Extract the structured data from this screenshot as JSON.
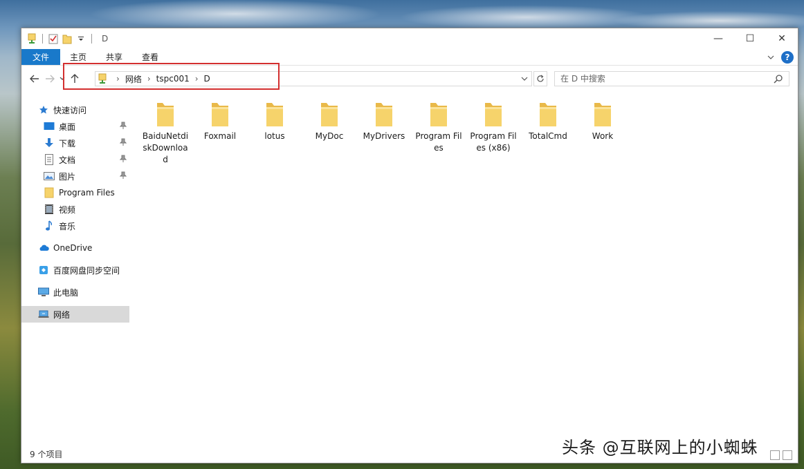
{
  "window": {
    "title": "D",
    "controls": {
      "minimize": "—",
      "maximize": "☐",
      "close": "✕"
    }
  },
  "ribbon": {
    "tabs": [
      {
        "label": "文件"
      },
      {
        "label": "主页"
      },
      {
        "label": "共享"
      },
      {
        "label": "查看"
      }
    ]
  },
  "address": {
    "breadcrumbs": [
      "网络",
      "tspc001",
      "D"
    ]
  },
  "search": {
    "placeholder": "在 D 中搜索"
  },
  "sidebar": {
    "items": [
      {
        "label": "快速访问",
        "icon": "star-icon"
      },
      {
        "label": "桌面",
        "icon": "desktop-icon",
        "pinned": true
      },
      {
        "label": "下载",
        "icon": "download-icon",
        "pinned": true
      },
      {
        "label": "文档",
        "icon": "document-icon",
        "pinned": true
      },
      {
        "label": "图片",
        "icon": "picture-icon",
        "pinned": true
      },
      {
        "label": "Program Files",
        "icon": "folder-icon"
      },
      {
        "label": "视频",
        "icon": "video-icon"
      },
      {
        "label": "音乐",
        "icon": "music-icon"
      },
      {
        "label": "OneDrive",
        "icon": "cloud-icon"
      },
      {
        "label": "百度网盘同步空间",
        "icon": "baidu-sync-icon"
      },
      {
        "label": "此电脑",
        "icon": "computer-icon"
      },
      {
        "label": "网络",
        "icon": "network-icon",
        "selected": true
      }
    ]
  },
  "content": {
    "folders": [
      {
        "label": "BaiduNetdiskDownload"
      },
      {
        "label": "Foxmail"
      },
      {
        "label": "lotus"
      },
      {
        "label": "MyDoc"
      },
      {
        "label": "MyDrivers"
      },
      {
        "label": "Program Files"
      },
      {
        "label": "Program Files (x86)"
      },
      {
        "label": "TotalCmd"
      },
      {
        "label": "Work"
      }
    ]
  },
  "status": {
    "item_count": "9 个项目"
  },
  "watermark": {
    "text": "头条 @互联网上的小蜘蛛"
  },
  "colors": {
    "file_tab": "#1979ca",
    "highlight": "#d32f2f",
    "folder": "#f6d36b",
    "selected": "#d9d9d9"
  }
}
